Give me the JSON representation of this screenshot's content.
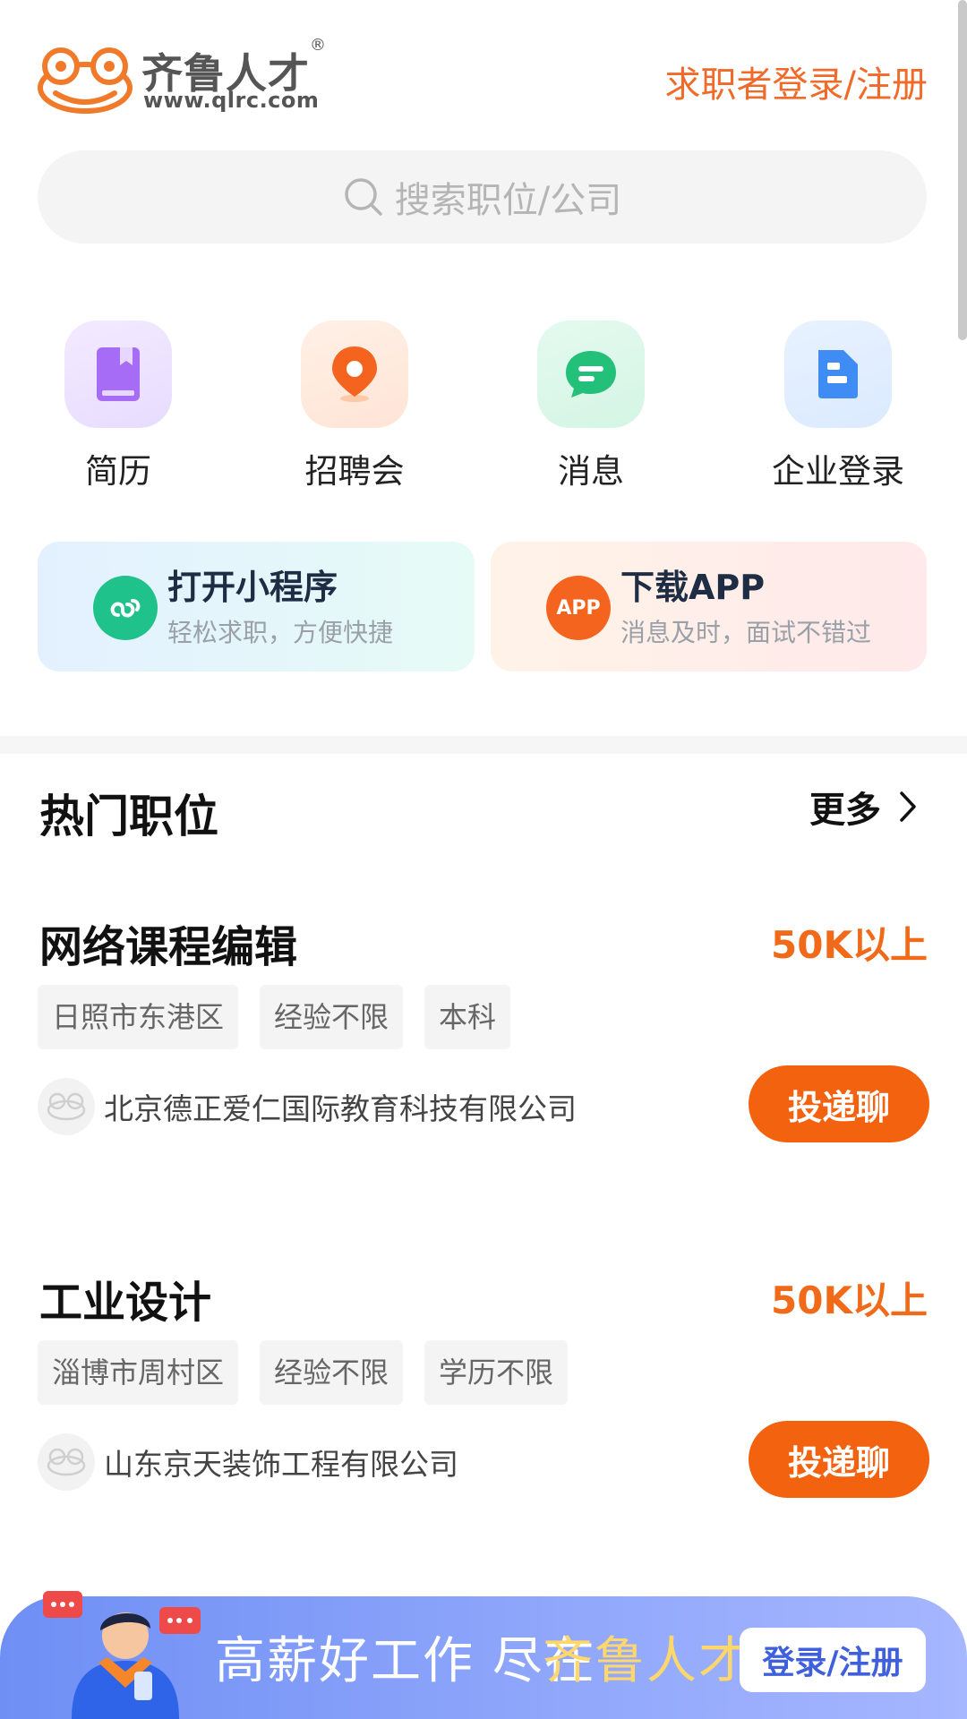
{
  "header": {
    "logo_name": "齐鲁人才",
    "logo_reg": "®",
    "logo_url": "www.qlrc.com",
    "login_link": "求职者登录/注册"
  },
  "search": {
    "placeholder": "搜索职位/公司"
  },
  "quick_links": [
    {
      "label": "简历",
      "icon": "resume-book-icon",
      "color": "#a66cf5"
    },
    {
      "label": "招聘会",
      "icon": "location-pin-icon",
      "color": "#f5641e"
    },
    {
      "label": "消息",
      "icon": "chat-bubble-icon",
      "color": "#23c07a"
    },
    {
      "label": "企业登录",
      "icon": "enterprise-icon",
      "color": "#3f8cf5"
    }
  ],
  "promos": {
    "mini": {
      "title": "打开小程序",
      "subtitle": "轻松求职，方便快捷",
      "icon": "mini-program-icon"
    },
    "app": {
      "title": "下载APP",
      "subtitle": "消息及时，面试不错过",
      "badge": "APP"
    }
  },
  "hot_jobs": {
    "title": "热门职位",
    "more": "更多",
    "items": [
      {
        "title": "网络课程编辑",
        "salary": "50K以上",
        "tags": [
          "日照市东港区",
          "经验不限",
          "本科"
        ],
        "company": "北京德正爱仁国际教育科技有限公司",
        "action": "投递聊"
      },
      {
        "title": "工业设计",
        "salary": "50K以上",
        "tags": [
          "淄博市周村区",
          "经验不限",
          "学历不限"
        ],
        "company": "山东京天装饰工程有限公司",
        "action": "投递聊"
      }
    ]
  },
  "banner": {
    "text": "高薪好工作 尽在",
    "brand": "齐鲁人才",
    "button": "登录/注册"
  },
  "colors": {
    "accent": "#f06a1a",
    "banner": "#7f9bf7"
  }
}
